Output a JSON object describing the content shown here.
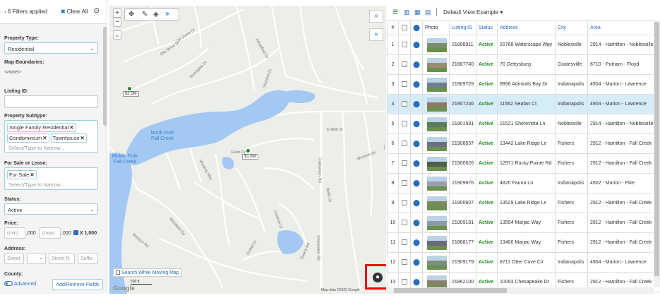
{
  "filters": {
    "applied_label": "6 Filters applied",
    "clear_label": "Clear All",
    "property_type": {
      "label": "Property Type:",
      "value": "Residential"
    },
    "map_boundaries": {
      "label": "Map Boundaries:",
      "value": "<none>"
    },
    "listing_id": {
      "label": "Listing ID:",
      "value": ""
    },
    "property_subtype": {
      "label": "Property Subtype:",
      "chips": [
        "Single Family Residential",
        "Condominium",
        "Townhouse"
      ],
      "placeholder": "Select/Type to Narrow..."
    },
    "for_sale_lease": {
      "label": "For Sale or Lease:",
      "chips": [
        "For Sale"
      ],
      "placeholder": "Select/Type to Narrow..."
    },
    "status": {
      "label": "Status:",
      "value": "Active"
    },
    "price": {
      "label": "Price:",
      "min_placeholder": "(min)",
      "max_placeholder": "(max)",
      "suffix": ",000",
      "multiplier": "X 1,000"
    },
    "address": {
      "label": "Address:",
      "street_placeholder": "Street",
      "street_name_placeholder": "Street N",
      "suffix_placeholder": "Suffix"
    },
    "county": {
      "label": "County:"
    },
    "advanced_label": "Advanced",
    "add_remove_label": "Add/Remove Fields"
  },
  "map": {
    "zoom_in": "+",
    "zoom_out": "−",
    "markers": [
      {
        "label": "$2.5M"
      },
      {
        "label": "$1.6M"
      }
    ],
    "lakes": [
      "North Fork Fall Creek",
      "Middle Fork Fall Creek"
    ],
    "roads": [
      "Old Stone Dr",
      "Old Stone Dr",
      "Stonegate Dr",
      "Woodfield Dr",
      "Stonehill Dr",
      "E 86th St",
      "Oaklandon Rd",
      "Gratz Dr",
      "Winding Way",
      "Westfield Rd",
      "Bricklyn Rd",
      "Corbel Dr",
      "Colonial Dr",
      "Quarry Rd",
      "Oaklandon Rd",
      "Westrick Dr",
      "Nellis Ct"
    ],
    "search_while_moving": "Search While Moving Map",
    "google": "Google",
    "scale": "500 ft",
    "attribution": "Map data ©2023 Google",
    "collapse_right": "»",
    "collapse_left": "«"
  },
  "grid": {
    "view_name": "Default View Example",
    "columns": [
      "#",
      "",
      "",
      "Photo",
      "Listing ID",
      "Status",
      "Address",
      "City",
      "Area"
    ],
    "rows": [
      {
        "n": "1",
        "id": "21898911",
        "status": "Active",
        "address": "20768 Waterscape Way",
        "city": "Noblesville",
        "area": "2914 - Hamilton - Noblesville"
      },
      {
        "n": "2",
        "id": "21887740",
        "status": "Active",
        "address": "70 Gettysburg",
        "city": "Coatesville",
        "area": "6710 - Putnam - Floyd"
      },
      {
        "n": "3",
        "id": "21909729",
        "status": "Active",
        "address": "8956 Admirals Bay Dr",
        "city": "Indianapolis",
        "area": "4904 - Marion - Lawrence"
      },
      {
        "n": "4",
        "id": "21907246",
        "status": "Active",
        "address": "11562 Seafan Ct",
        "city": "Indianapolis",
        "area": "4904 - Marion - Lawrence"
      },
      {
        "n": "5",
        "id": "21901581",
        "status": "Active",
        "address": "21521 Shorevista Ln",
        "city": "Noblesville",
        "area": "2914 - Hamilton - Noblesville"
      },
      {
        "n": "6",
        "id": "21908557",
        "status": "Active",
        "address": "13442 Lake Ridge Ln",
        "city": "Fishers",
        "area": "2912 - Hamilton - Fall Creek"
      },
      {
        "n": "7",
        "id": "21900626",
        "status": "Active",
        "address": "12971 Rocky Pointe Rd",
        "city": "Fishers",
        "area": "2912 - Hamilton - Fall Creek"
      },
      {
        "n": "8",
        "id": "21909676",
        "status": "Active",
        "address": "4820 Fauna Ln",
        "city": "Indianapolis",
        "area": "4902 - Marion - Pike"
      },
      {
        "n": "9",
        "id": "21900607",
        "status": "Active",
        "address": "13529 Lake Ridge Ln",
        "city": "Fishers",
        "area": "2912 - Hamilton - Fall Creek"
      },
      {
        "n": "10",
        "id": "21909181",
        "status": "Active",
        "address": "13554 Marjac Way",
        "city": "Fishers",
        "area": "2912 - Hamilton - Fall Creek"
      },
      {
        "n": "11",
        "id": "21868177",
        "status": "Active",
        "address": "13400 Marjac Way",
        "city": "Fishers",
        "area": "2912 - Hamilton - Fall Creek"
      },
      {
        "n": "12",
        "id": "21909179",
        "status": "Active",
        "address": "8711 Otter Cove Cir",
        "city": "Indianapolis",
        "area": "4904 - Marion - Lawrence"
      },
      {
        "n": "13",
        "id": "21862100",
        "status": "Active",
        "address": "10093 Chesapeake Dr",
        "city": "Fishers",
        "area": "2912 - Hamilton - Fall Creek"
      }
    ]
  },
  "colors": {
    "accent": "#2a6ebb",
    "active_status": "#1e8a1e",
    "selected_row": "#d6ecf6",
    "water": "#a3c8f2",
    "highlight_box": "#e00000"
  }
}
